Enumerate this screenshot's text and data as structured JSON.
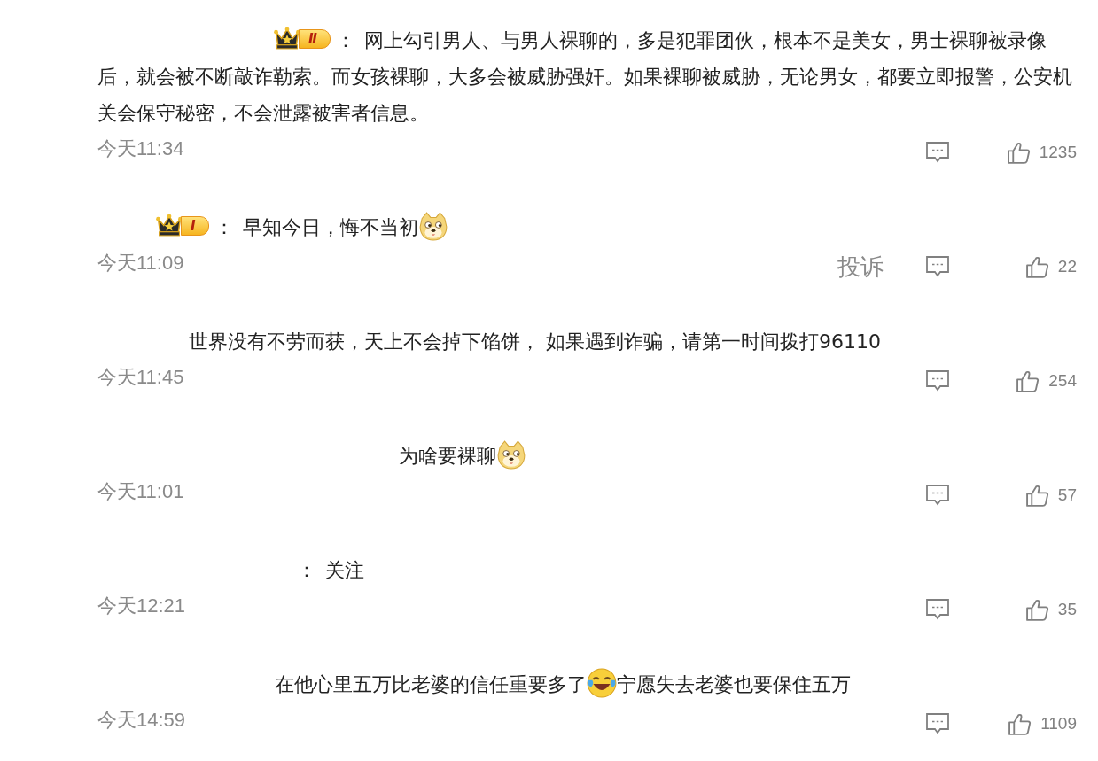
{
  "comments": [
    {
      "badge": "Ⅱ",
      "separator": "：",
      "content": [
        {
          "kind": "text",
          "text": "网上勾引男人、与男人裸聊的，多是犯罪团伙，根本不是美女，男士裸聊被录像后，就会被不断敲诈勒索。而女孩裸聊，大多会被威胁强奸。如果裸聊被威胁，无论男女，都要立即报警，公安机关会保守秘密，不会泄露被害者信息。"
        }
      ],
      "time": "今天11:34",
      "likes": "1235"
    },
    {
      "badge": "Ⅰ",
      "separator": "：",
      "content": [
        {
          "kind": "text",
          "text": "早知今日，悔不当初"
        },
        {
          "kind": "doge"
        }
      ],
      "time": "今天11:09",
      "report": "投诉",
      "likes": "22"
    },
    {
      "content": [
        {
          "kind": "text",
          "text": "世界没有不劳而获，天上不会掉下馅饼， 如果遇到诈骗，请第一时间拨打96110"
        }
      ],
      "time": "今天11:45",
      "likes": "254"
    },
    {
      "content": [
        {
          "kind": "text",
          "text": "为啥要裸聊"
        },
        {
          "kind": "doge"
        }
      ],
      "time": "今天11:01",
      "likes": "57"
    },
    {
      "separator": "：",
      "content": [
        {
          "kind": "text",
          "text": "关注"
        }
      ],
      "time": "今天12:21",
      "likes": "35"
    },
    {
      "content": [
        {
          "kind": "text",
          "text": "在他心里五万比老婆的信任重要多了"
        },
        {
          "kind": "laugh"
        },
        {
          "kind": "text",
          "text": "宁愿失去老婆也要保住五万"
        }
      ],
      "time": "今天14:59",
      "likes": "1109"
    }
  ]
}
